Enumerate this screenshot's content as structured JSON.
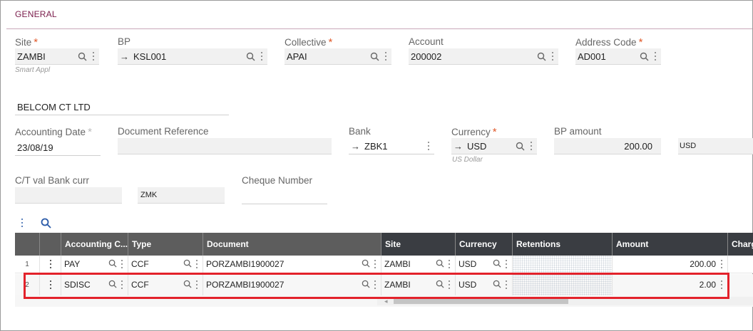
{
  "section": {
    "title": "GENERAL"
  },
  "fields": {
    "site": {
      "label": "Site",
      "value": "ZAMBI",
      "hint": "Smart Appl"
    },
    "bp": {
      "label": "BP",
      "value": "KSL001"
    },
    "collective": {
      "label": "Collective",
      "value": "APAI"
    },
    "account": {
      "label": "Account",
      "value": "200002"
    },
    "address_code": {
      "label": "Address Code",
      "value": "AD001"
    },
    "bp_name": {
      "value": "BELCOM CT LTD"
    },
    "accounting_date": {
      "label": "Accounting Date",
      "value": "23/08/19"
    },
    "document_reference": {
      "label": "Document Reference",
      "value": ""
    },
    "bank": {
      "label": "Bank",
      "value": "ZBK1"
    },
    "currency": {
      "label": "Currency",
      "value": "USD",
      "hint": "US Dollar"
    },
    "bp_amount": {
      "label": "BP amount",
      "value": "200.00",
      "currency": "USD"
    },
    "ct_val_bank_curr": {
      "label": "C/T val Bank curr",
      "value": "",
      "currency": "ZMK"
    },
    "cheque_number": {
      "label": "Cheque Number",
      "value": ""
    }
  },
  "required_marker": "*",
  "grid": {
    "columns": [
      "Accounting C...",
      "Type",
      "Document",
      "Site",
      "Currency",
      "Retentions",
      "Amount",
      "Charge"
    ],
    "rows": [
      {
        "num": "1",
        "accounting_code": "PAY",
        "type": "CCF",
        "document": "PORZAMBI1900027",
        "site": "ZAMBI",
        "currency": "USD",
        "amount": "200.00"
      },
      {
        "num": "2",
        "accounting_code": "SDISC",
        "type": "CCF",
        "document": "PORZAMBI1900027",
        "site": "ZAMBI",
        "currency": "USD",
        "amount": "2.00"
      }
    ]
  },
  "colors": {
    "accent": "#7a1b4a",
    "required": "#e05a2b",
    "highlight": "#e3222b",
    "header_dark": "#3a3d42",
    "header": "#5d5d5d"
  },
  "icons": [
    "search-icon",
    "kebab-menu-icon",
    "arrow-right-icon"
  ]
}
